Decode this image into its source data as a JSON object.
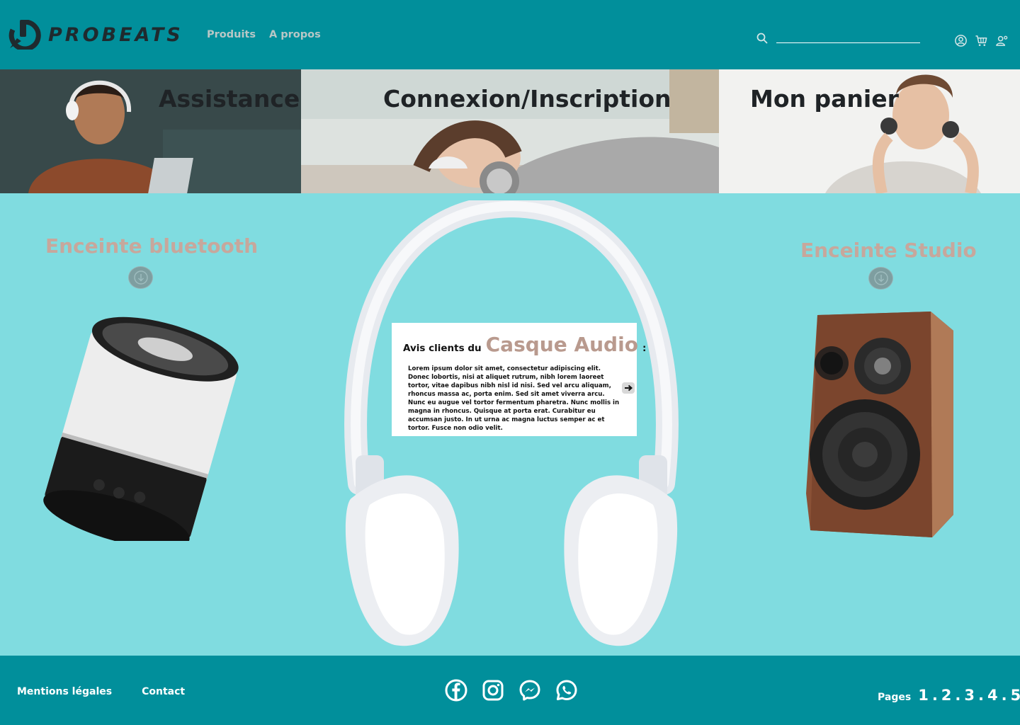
{
  "brand": {
    "name": "PROBEATS",
    "logo_icon": "probeats-logo-icon"
  },
  "nav": {
    "items": [
      "Produits",
      "A propos"
    ]
  },
  "search": {
    "placeholder": "",
    "icon": "search-icon"
  },
  "header_icons": [
    "user-circle-icon",
    "cart-icon",
    "user-settings-icon"
  ],
  "banners": [
    {
      "title": "Assistance"
    },
    {
      "title": "Connexion/Inscription"
    },
    {
      "title": "Mon panier"
    }
  ],
  "products": {
    "left": {
      "label": "Enceinte bluetooth"
    },
    "right": {
      "label": "Enceinte Studio"
    }
  },
  "review": {
    "prefix": "Avis clients du",
    "product": "Casque Audio",
    "suffix": ":",
    "body": "Lorem ipsum dolor sit amet, consectetur adipiscing elit. Donec lobortis, nisi at aliquet rutrum, nibh lorem laoreet tortor, vitae dapibus nibh nisl id nisi. Sed vel arcu aliquam, rhoncus massa ac, porta enim. Sed sit amet viverra arcu. Nunc eu augue vel tortor fermentum pharetra. Nunc mollis in magna in rhoncus. Quisque at porta erat. Curabitur eu accumsan justo. In ut urna ac magna luctus semper ac et tortor. Fusce non odio velit."
  },
  "footer": {
    "links": [
      "Mentions légales",
      "Contact"
    ],
    "social": [
      "facebook-icon",
      "instagram-icon",
      "messenger-icon",
      "whatsapp-icon"
    ],
    "pages_label": "Pages",
    "pages": [
      "1",
      ".",
      "2",
      ".",
      "3",
      ".",
      "4",
      ".",
      "5"
    ]
  },
  "colors": {
    "header_bg": "#018F9B",
    "page_bg": "#80DCE0",
    "product_label": "#C7A79C",
    "review_product": "#B99A8E"
  }
}
